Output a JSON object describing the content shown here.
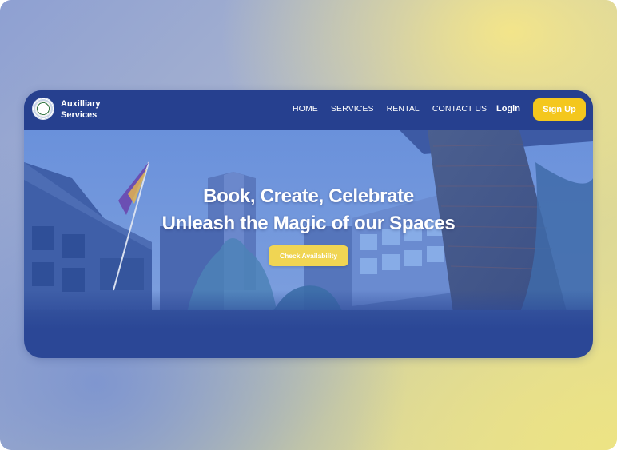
{
  "header": {
    "brand_line1": "Auxilliary",
    "brand_line2": "Services",
    "logo_icon": "seal-logo-icon"
  },
  "nav": {
    "items": [
      {
        "label": "HOME"
      },
      {
        "label": "SERVICES"
      },
      {
        "label": "RENTAL"
      },
      {
        "label": "CONTACT US"
      }
    ],
    "login_label": "Login",
    "signup_label": "Sign Up"
  },
  "hero": {
    "headline_line1": "Book, Create, Celebrate",
    "headline_line2": "Unleash the Magic of our Spaces",
    "cta_label": "Check Availability"
  },
  "colors": {
    "navbar": "#26408f",
    "accent": "#f4c71d",
    "cta": "#f0d553",
    "text": "#ffffff"
  }
}
